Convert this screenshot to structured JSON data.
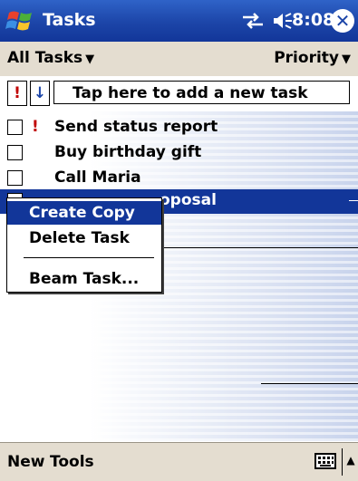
{
  "title_bar": {
    "app_title": "Tasks",
    "clock": "8:08",
    "close_glyph": "✕",
    "icons": [
      "windows-logo-icon",
      "connectivity-icon",
      "volume-icon",
      "close-icon"
    ]
  },
  "filter_bar": {
    "category": "All Tasks",
    "sort": "Priority",
    "caret": "▼"
  },
  "entry_bar": {
    "high_priority_glyph": "!",
    "low_priority_glyph": "↓",
    "placeholder": "Tap here to add a new task"
  },
  "tasks": [
    {
      "label": "Send status report",
      "priority": "!",
      "completed": false
    },
    {
      "label": "Buy birthday gift",
      "priority": "",
      "completed": false
    },
    {
      "label": "Call Maria",
      "priority": "",
      "completed": false
    },
    {
      "label": "oposal",
      "priority": "",
      "completed": false,
      "selected": true
    }
  ],
  "context_menu": {
    "items": [
      "Create Copy",
      "Delete Task",
      "Beam Task..."
    ],
    "highlighted": "Create Copy"
  },
  "bottom_bar": {
    "menu_new": "New",
    "menu_tools": "Tools",
    "sip_arrow": "▲"
  },
  "colors": {
    "title_bar": "#1c45a8",
    "selection": "#123699",
    "toolbar_bg": "#e4ddd0",
    "priority_red": "#c00000"
  }
}
